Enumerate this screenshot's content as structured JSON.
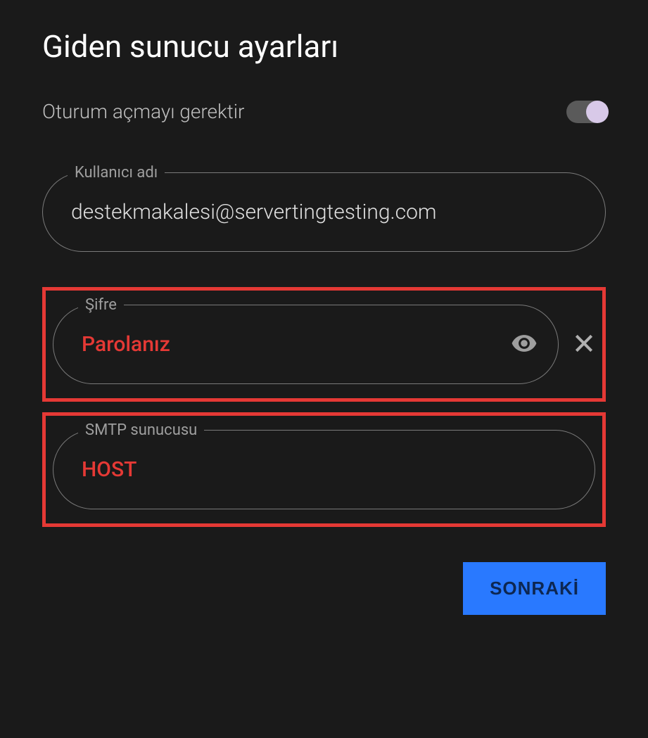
{
  "header": {
    "title": "Giden sunucu ayarları"
  },
  "toggle": {
    "label": "Oturum açmayı gerektir",
    "enabled": true
  },
  "fields": {
    "username": {
      "label": "Kullanıcı adı",
      "value": "destekmakalesi@servertingtesting.com"
    },
    "password": {
      "label": "Şifre",
      "value": "Parolanız"
    },
    "smtp": {
      "label": "SMTP sunucusu",
      "value": "HOST"
    }
  },
  "buttons": {
    "next": "SONRAKİ"
  }
}
